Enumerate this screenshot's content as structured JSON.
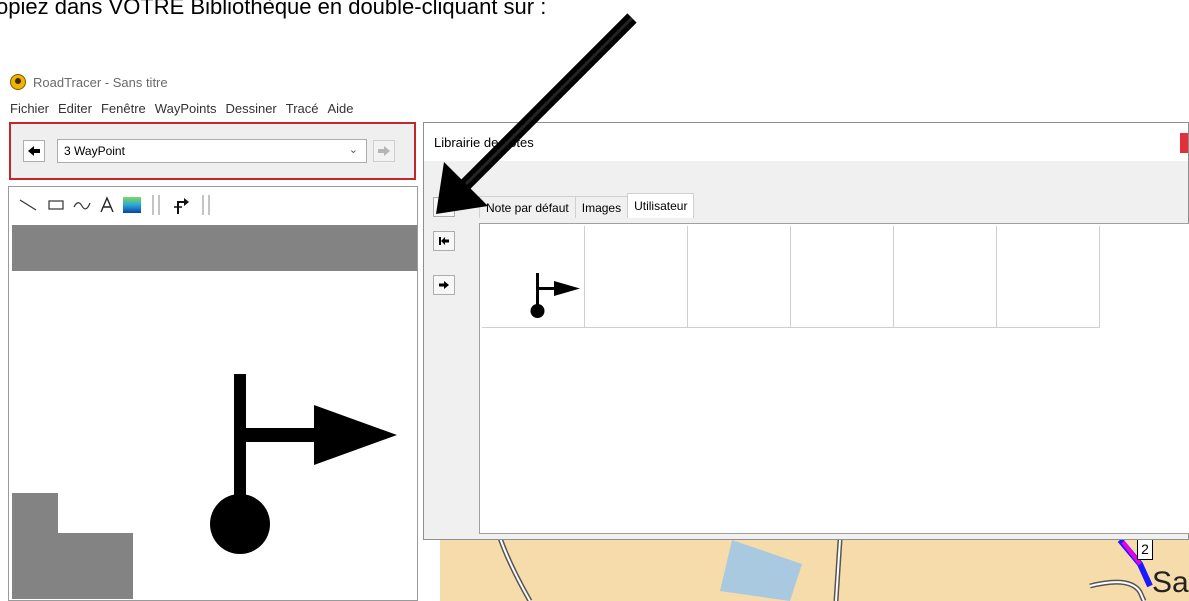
{
  "document": {
    "instruction_fragment": "opiez dans VOTRE Bibliothèque en double-cliquant sur :"
  },
  "app": {
    "title": "RoadTracer - Sans titre"
  },
  "menu": [
    "Fichier",
    "Editer",
    "Fenêtre",
    "WayPoints",
    "Dessiner",
    "Tracé",
    "Aide"
  ],
  "route_panel": {
    "combo_value": "3 WayPoint"
  },
  "dialog": {
    "title": "Librairie de notes",
    "tabs": [
      {
        "label": "Note par défaut",
        "active": false
      },
      {
        "label": "Images",
        "active": false
      },
      {
        "label": "Utilisateur",
        "active": true
      }
    ]
  },
  "map_labels": {
    "marker_number": "2",
    "place_text": "Sa"
  },
  "colors": {
    "highlight_border": "#c1272d",
    "map_background": "#f6dcaa"
  },
  "icons": {
    "back": "arrow-left-icon",
    "forward": "arrow-right-icon",
    "first": "arrow-to-start-icon",
    "turn_right": "turn-right-waypoint-icon"
  }
}
